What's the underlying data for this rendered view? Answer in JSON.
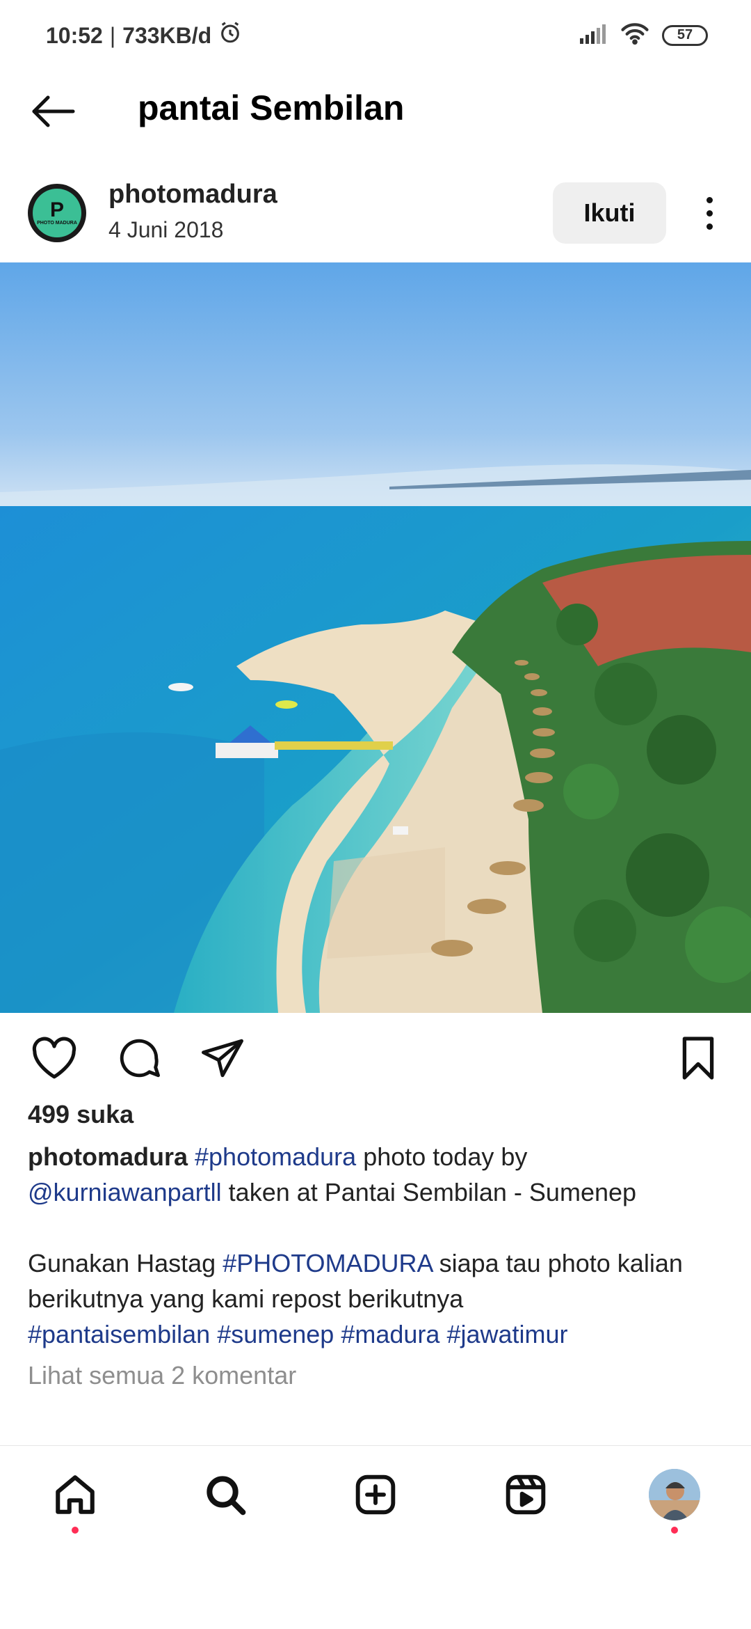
{
  "status_bar": {
    "time": "10:52",
    "separator": "|",
    "network_speed": "733KB/d",
    "battery": "57",
    "icons": [
      "alarm-icon",
      "signal-icon",
      "wifi-icon",
      "battery-icon"
    ]
  },
  "header": {
    "title": "pantai Sembilan",
    "back_icon": "arrow-left-icon"
  },
  "post": {
    "username": "photomadura",
    "date": "4 Juni 2018",
    "follow_label": "Ikuti",
    "avatar_letter": "P",
    "avatar_text": "PHOTO MADURA",
    "likes": "499 suka",
    "caption": {
      "author": "photomadura",
      "tag1": "#photomadura",
      "text1": " photo today by",
      "mention": "@kurniawanpartll",
      "text2": " taken at Pantai Sembilan - Sumenep",
      "text3": "Gunakan Hastag ",
      "tag2": "#PHOTOMADURA",
      "text4": " siapa tau photo kalian berikutnya yang kami repost berikutnya",
      "tags": [
        "#pantaisembilan",
        "#sumenep",
        "#madura",
        "#jawatimur"
      ]
    },
    "view_comments": "Lihat semua 2 komentar"
  },
  "actions": [
    "heart-icon",
    "comment-icon",
    "share-icon",
    "bookmark-icon"
  ],
  "bottom_nav": [
    "home-icon",
    "search-icon",
    "create-icon",
    "reels-icon",
    "profile-avatar"
  ],
  "colors": {
    "hashtag": "#1e3a8a",
    "follow_bg": "#efefef",
    "notification_dot": "#ff2d55",
    "muted": "#8e8e8e"
  }
}
